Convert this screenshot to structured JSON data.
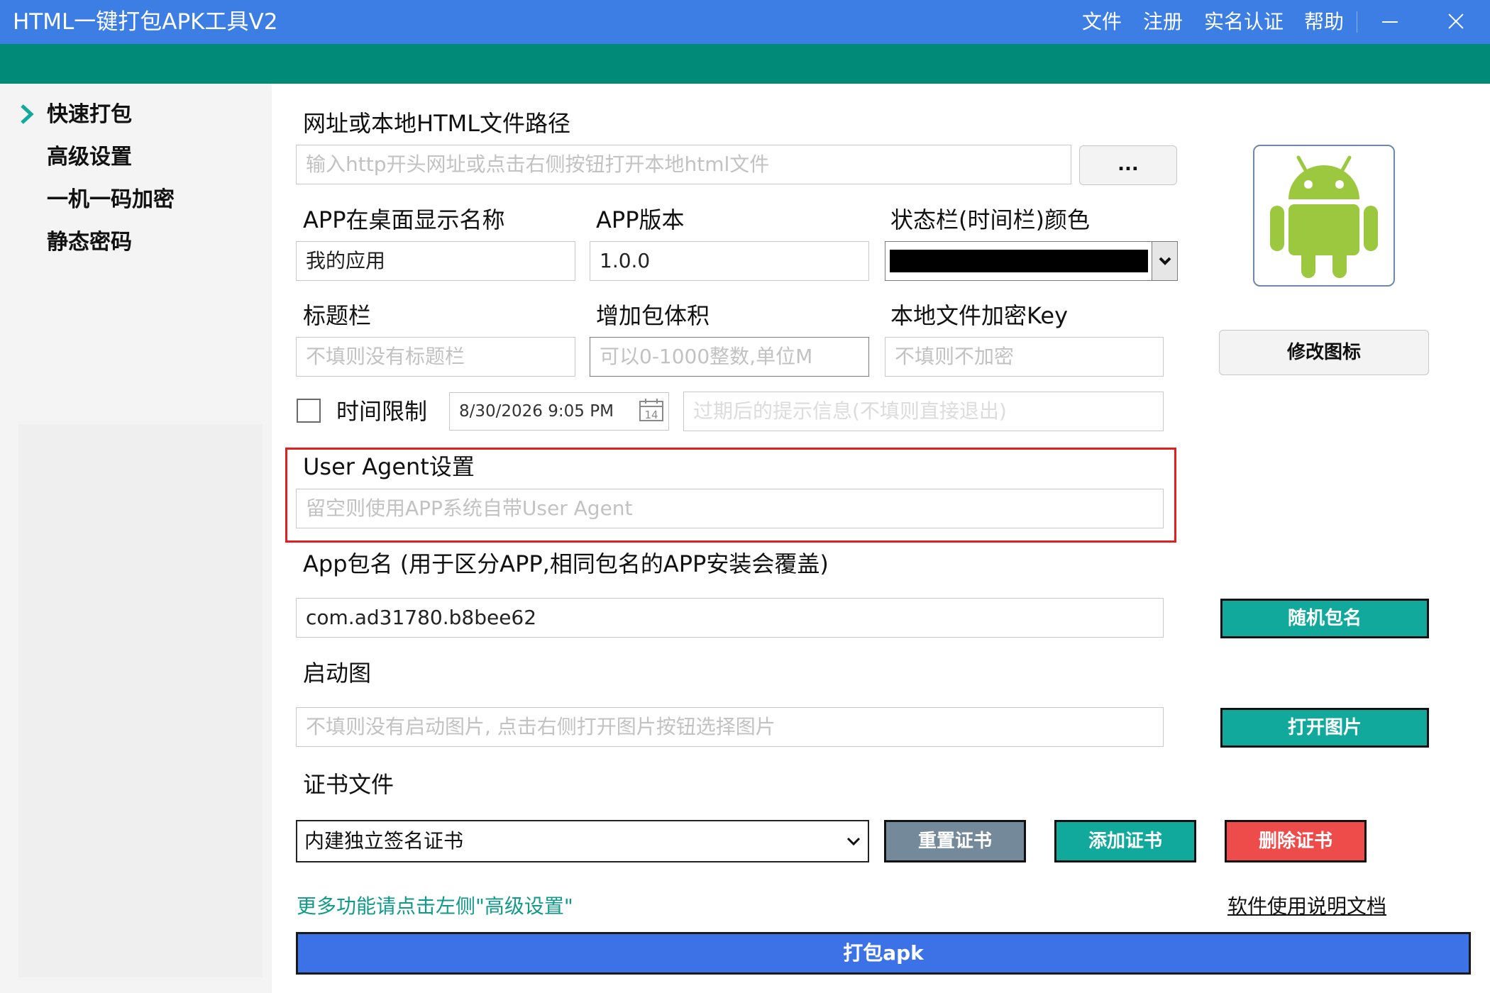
{
  "window": {
    "title": "HTML一键打包APK工具V2",
    "menu": [
      "文件",
      "注册",
      "实名认证",
      "帮助"
    ]
  },
  "sidebar": {
    "items": [
      {
        "label": "快速打包",
        "active": true
      },
      {
        "label": "高级设置",
        "active": false
      },
      {
        "label": "一机一码加密",
        "active": false
      },
      {
        "label": "静态密码",
        "active": false
      }
    ]
  },
  "form": {
    "url": {
      "label": "网址或本地HTML文件路径",
      "placeholder": "输入http开头网址或点击右侧按钮打开本地html文件",
      "browse_label": "..."
    },
    "app_name": {
      "label": "APP在桌面显示名称",
      "value": "我的应用"
    },
    "app_version": {
      "label": "APP版本",
      "value": "1.0.0"
    },
    "status_bar_color": {
      "label": "状态栏(时间栏)颜色",
      "value": "#000000"
    },
    "title_bar": {
      "label": "标题栏",
      "placeholder": "不填则没有标题栏"
    },
    "package_size": {
      "label": "增加包体积",
      "placeholder": "可以0-1000整数,单位M"
    },
    "encrypt_key": {
      "label": "本地文件加密Key",
      "placeholder": "不填则不加密"
    },
    "time_limit": {
      "label": "时间限制",
      "checked": false,
      "date": "8/30/2026 9:05 PM",
      "calendar_day": "14",
      "message_placeholder": "过期后的提示信息(不填则直接退出)"
    },
    "user_agent": {
      "label": "User Agent设置",
      "placeholder": "留空则使用APP系统自带User Agent"
    },
    "package_name": {
      "label": "App包名 (用于区分APP,相同包名的APP安装会覆盖)",
      "value": "com.ad31780.b8bee62",
      "random_label": "随机包名"
    },
    "splash": {
      "label": "启动图",
      "placeholder": "不填则没有启动图片, 点击右侧打开图片按钮选择图片",
      "open_label": "打开图片"
    },
    "certificate": {
      "label": "证书文件",
      "value": "内建独立签名证书",
      "reset_label": "重置证书",
      "add_label": "添加证书",
      "delete_label": "删除证书"
    }
  },
  "icon": {
    "change_label": "修改图标",
    "icon_name": "android-robot-icon"
  },
  "footer": {
    "hint": "更多功能请点击左侧\"高级设置\"",
    "doc_link": "软件使用说明文档",
    "build_label": "打包apk"
  },
  "colors": {
    "titlebar": "#3d7ee4",
    "greenbar": "#008a77",
    "teal": "#11a99c",
    "slate": "#748999",
    "red": "#ee4b4b",
    "blue": "#3d72e6",
    "highlight": "#e02020"
  }
}
